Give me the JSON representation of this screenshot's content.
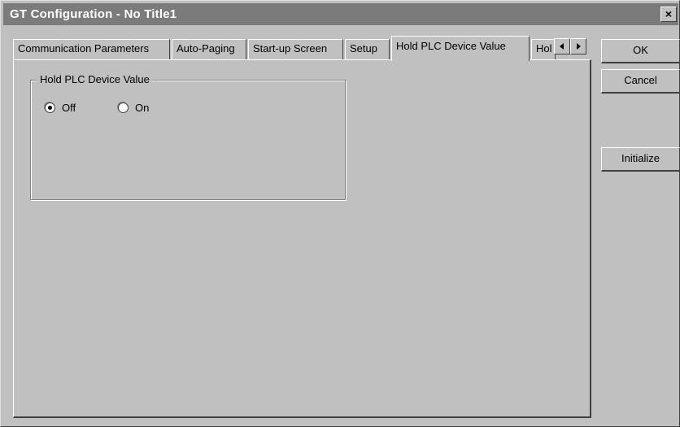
{
  "window": {
    "title": "GT Configuration - No Title1",
    "close_glyph": "✕"
  },
  "tabs": [
    {
      "label": "Communication Parameters",
      "active": false
    },
    {
      "label": "Auto-Paging",
      "active": false
    },
    {
      "label": "Start-up Screen",
      "active": false
    },
    {
      "label": "Setup",
      "active": false
    },
    {
      "label": "Hold PLC Device Value",
      "active": true
    },
    {
      "label": "Hol",
      "active": false
    }
  ],
  "tab_scroll": {
    "left_icon": "left-arrow-icon",
    "right_icon": "right-arrow-icon"
  },
  "group": {
    "label": "Hold PLC Device Value",
    "options": [
      {
        "label": "Off",
        "checked": true
      },
      {
        "label": "On",
        "checked": false
      }
    ]
  },
  "buttons": {
    "ok": "OK",
    "cancel": "Cancel",
    "initialize": "Initialize"
  }
}
